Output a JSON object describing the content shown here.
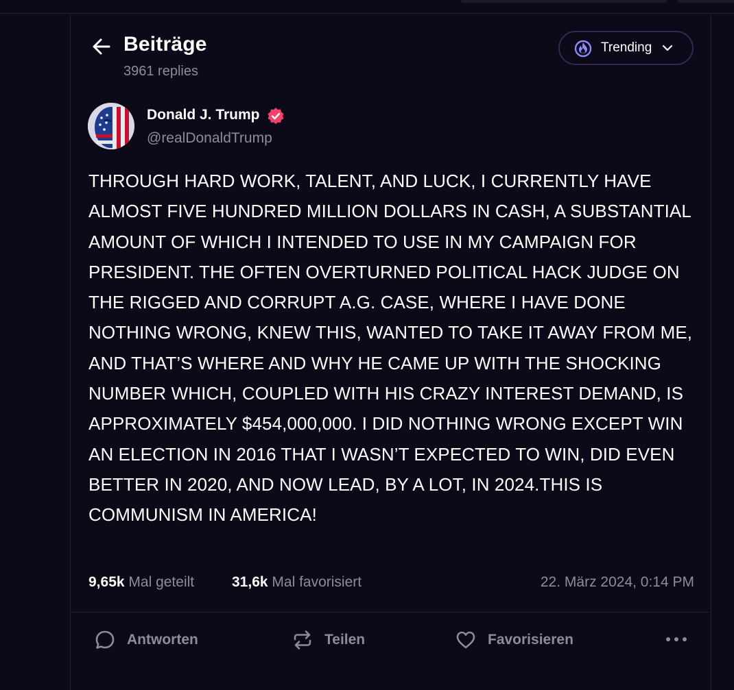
{
  "header": {
    "title": "Beiträge",
    "reply_count": "3961 replies",
    "sort_label": "Trending"
  },
  "author": {
    "name": "Donald J. Trump",
    "handle": "@realDonaldTrump",
    "verified": true
  },
  "post": {
    "text": "THROUGH HARD WORK, TALENT, AND LUCK, I CURRENTLY HAVE ALMOST FIVE HUNDRED MILLION DOLLARS IN CASH, A SUBSTANTIAL AMOUNT OF WHICH I INTENDED TO USE IN MY CAMPAIGN FOR PRESIDENT. THE OFTEN OVERTURNED POLITICAL HACK JUDGE ON THE RIGGED AND CORRUPT A.G. CASE, WHERE I HAVE DONE NOTHING WRONG,  KNEW THIS, WANTED TO TAKE IT AWAY FROM ME, AND THAT’S WHERE AND WHY HE CAME UP WITH THE SHOCKING NUMBER WHICH, COUPLED WITH HIS CRAZY INTEREST DEMAND, IS APPROXIMATELY $454,000,000. I DID NOTHING WRONG EXCEPT WIN AN ELECTION IN 2016 THAT I WASN’T EXPECTED TO WIN, DID EVEN BETTER IN 2020, AND NOW LEAD, BY A LOT, IN 2024.THIS IS COMMUNISM IN AMERICA!"
  },
  "stats": {
    "shares_count": "9,65k",
    "shares_label": "Mal geteilt",
    "favorites_count": "31,6k",
    "favorites_label": "Mal favorisiert",
    "timestamp": "22. März 2024, 0:14 PM"
  },
  "actions": {
    "reply": "Antworten",
    "share": "Teilen",
    "favorite": "Favorisieren"
  },
  "colors": {
    "background": "#0c0919",
    "muted_text": "#8e8b9f",
    "accent": "#6b6bff",
    "verified": "#f5426c"
  },
  "icons": {
    "back": "arrow-left-icon",
    "sort": "flame-icon",
    "dropdown": "chevron-down-icon",
    "verified": "verified-badge-icon",
    "reply": "speech-bubble-icon",
    "share": "repost-icon",
    "favorite": "heart-icon",
    "more": "more-dots-icon"
  }
}
